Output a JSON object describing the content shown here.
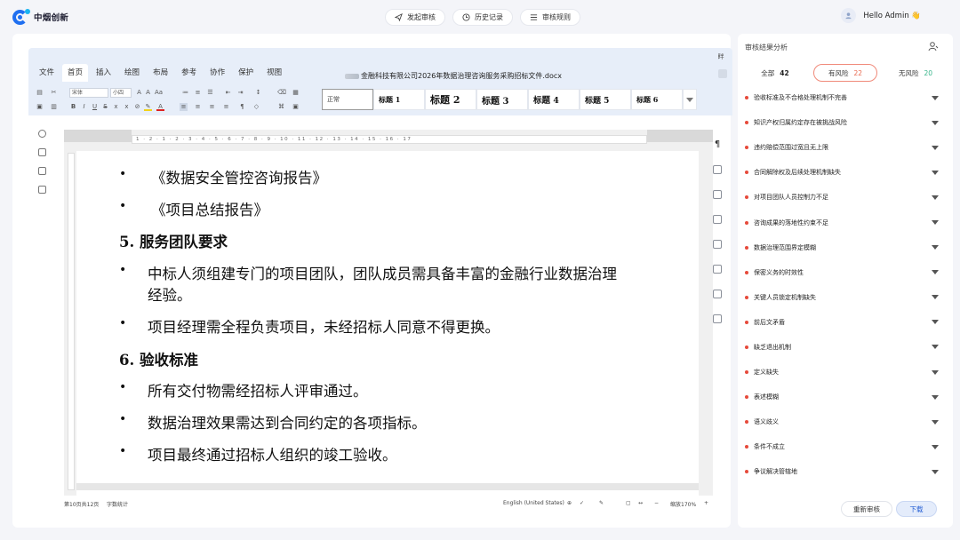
{
  "app": {
    "name": "中烟创新",
    "brand_color": "#1f6ff0"
  },
  "topnav": [
    {
      "label": "发起审核",
      "icon": "send-icon"
    },
    {
      "label": "历史记录",
      "icon": "clock-icon"
    },
    {
      "label": "审核规则",
      "icon": "rules-icon"
    }
  ],
  "user": {
    "greeting": "Hello Admin 👋"
  },
  "editor": {
    "menu": [
      "文件",
      "首页",
      "插入",
      "绘图",
      "布局",
      "参考",
      "协作",
      "保护",
      "视图"
    ],
    "active_menu": "首页",
    "doc_title": "金融科技有限公司2026年数据治理咨询服务采购招标文件.docx",
    "corner_label": "眫",
    "font_name": "宋体",
    "font_size": "小四",
    "styles": [
      "正常",
      "标题 1",
      "标题 2",
      "标题 3",
      "标题 4",
      "标题 5",
      "标题 6"
    ],
    "ruler_marks": "1 · 2 · 1 · 2 · 3 · 4 · 5 · 6 · 7 · 8 · 9 · 10 · 11 · 12 · 13 · 14 · 15 · 16 · 17",
    "content": [
      {
        "bullet": "•",
        "text": "《数据安全管控咨询报告》"
      },
      {
        "bullet": "•",
        "text": "《项目总结报告》"
      },
      {
        "bullet": "",
        "text": "5.  服务团队要求",
        "heading": true
      },
      {
        "bullet": "•",
        "text": "中标人须组建专门的项目团队，团队成员需具备丰富的金融行业数据治理"
      },
      {
        "bullet": "",
        "text": "经验。"
      },
      {
        "bullet": "•",
        "text": "项目经理需全程负责项目，未经招标人同意不得更换。"
      },
      {
        "bullet": "",
        "text": "6.  验收标准",
        "heading": true
      },
      {
        "bullet": "•",
        "text": "所有交付物需经招标人评审通过。"
      },
      {
        "bullet": "•",
        "text": "数据治理效果需达到合同约定的各项指标。"
      },
      {
        "bullet": "•",
        "text": "项目最终通过招标人组织的竣工验收。"
      }
    ],
    "status": {
      "page": "第10页共12页",
      "word_count": "字数统计",
      "language": "English (United States)",
      "zoom": "缩放170%"
    }
  },
  "panel": {
    "title": "审核结果分析",
    "tabs": [
      {
        "label": "全部",
        "count": "42"
      },
      {
        "label": "有风险",
        "count": "22"
      },
      {
        "label": "无风险",
        "count": "20"
      }
    ],
    "risks": [
      "验收标准及不合格处理机制不完善",
      "知识产权归属约定存在被挑战风险",
      "违约赔偿范围过宽且无上限",
      "合同解除权及后续处理机制缺失",
      "对项目团队人员控制力不足",
      "咨询成果的落地性约束不足",
      "数据治理范围界定模糊",
      "保密义务的时效性",
      "关键人员锁定机制缺失",
      "前后文矛盾",
      "缺乏退出机制",
      "定义缺失",
      "表述模糊",
      "语义歧义",
      "条件不成立",
      "争议解决管辖地"
    ],
    "risk_color": "#e64a3b",
    "buttons": {
      "reaudit": "重新审核",
      "download": "下载"
    }
  }
}
